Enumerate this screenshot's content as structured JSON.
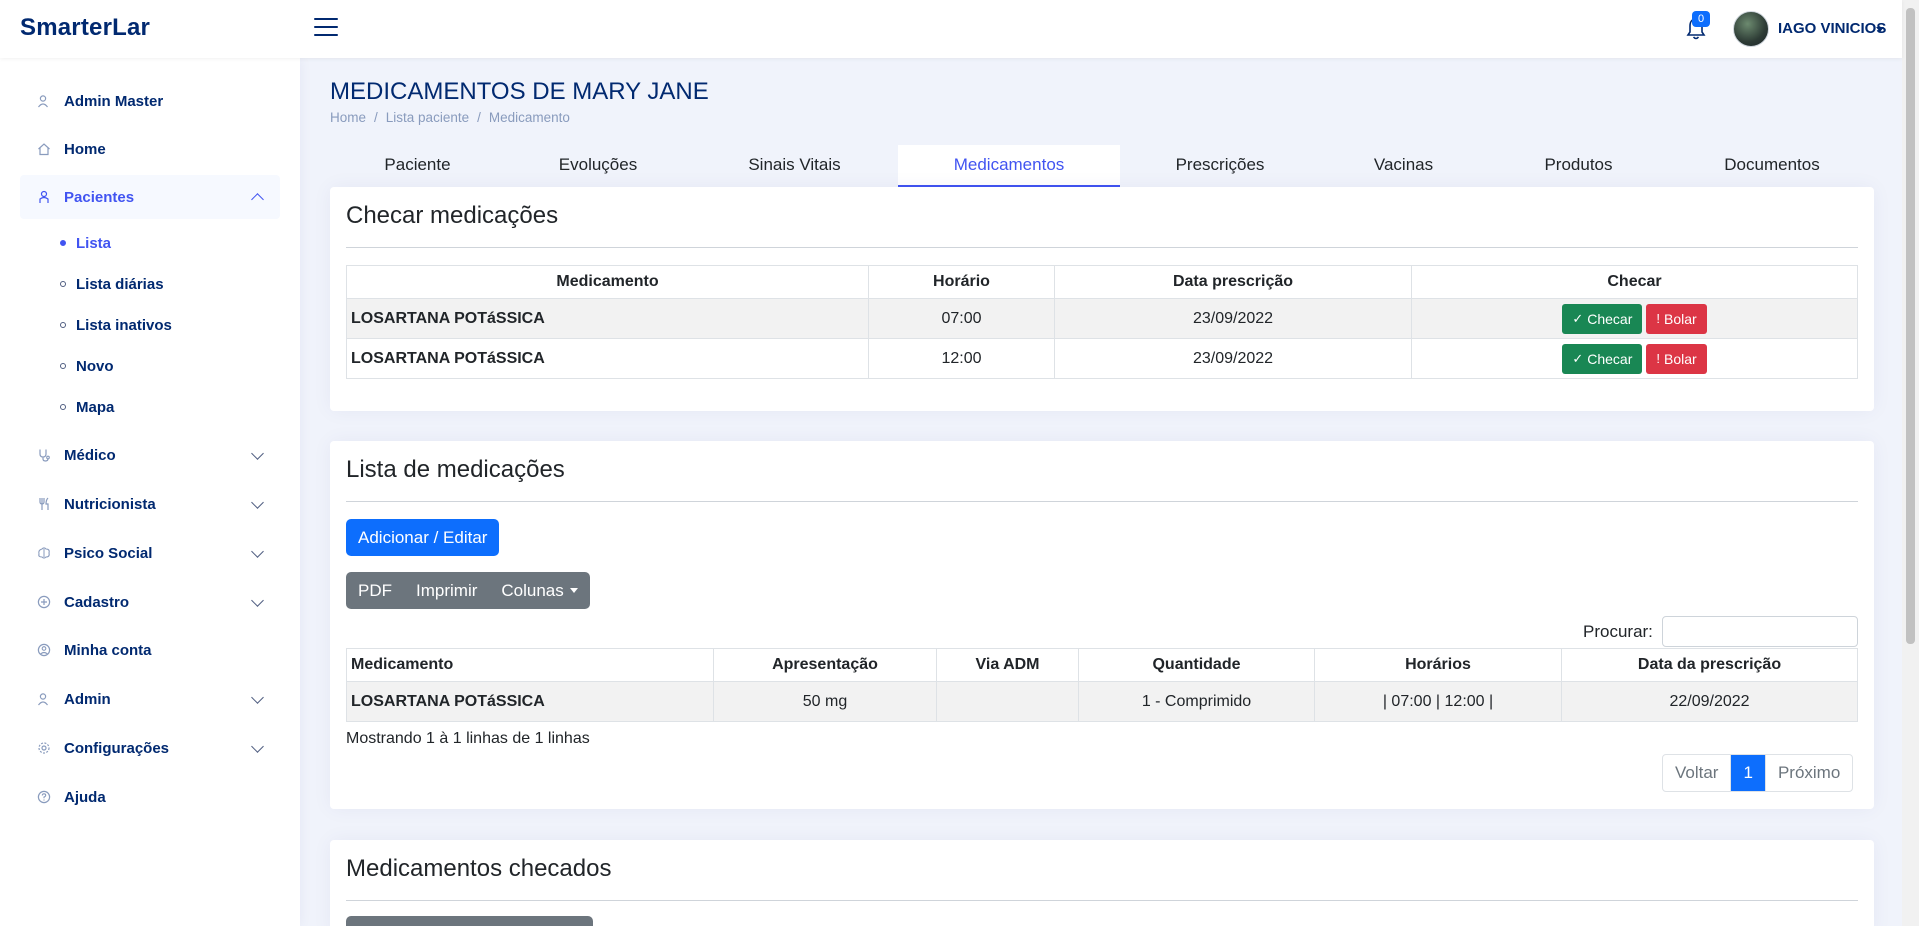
{
  "app": {
    "brand": "SmarterLar"
  },
  "header": {
    "notification_count": "0",
    "user_name": "IAGO VINICIOS"
  },
  "sidebar": {
    "items": [
      {
        "label": "Admin Master",
        "icon": "user-icon"
      },
      {
        "label": "Home",
        "icon": "home-icon"
      },
      {
        "label": "Pacientes",
        "icon": "person-icon",
        "expanded": true
      },
      {
        "label": "Médico",
        "icon": "stethoscope-icon"
      },
      {
        "label": "Nutricionista",
        "icon": "cutlery-icon"
      },
      {
        "label": "Psico Social",
        "icon": "brain-icon"
      },
      {
        "label": "Cadastro",
        "icon": "plus-circle-icon"
      },
      {
        "label": "Minha conta",
        "icon": "person-circle-icon"
      },
      {
        "label": "Admin",
        "icon": "user-gear-icon"
      },
      {
        "label": "Configurações",
        "icon": "gear-icon"
      },
      {
        "label": "Ajuda",
        "icon": "question-icon"
      }
    ],
    "pacientes_sub": [
      "Lista",
      "Lista diárias",
      "Lista inativos",
      "Novo",
      "Mapa"
    ]
  },
  "page": {
    "title": "MEDICAMENTOS DE MARY JANE",
    "breadcrumb": [
      "Home",
      "Lista paciente",
      "Medicamento"
    ]
  },
  "tabs": [
    "Paciente",
    "Evoluções",
    "Sinais Vitais",
    "Medicamentos",
    "Prescrições",
    "Vacinas",
    "Produtos",
    "Documentos"
  ],
  "checar": {
    "title": "Checar medicações",
    "headers": [
      "Medicamento",
      "Horário",
      "Data prescrição",
      "Checar"
    ],
    "rows": [
      {
        "medicamento": "LOSARTANA POTáSSICA",
        "horario": "07:00",
        "data": "23/09/2022"
      },
      {
        "medicamento": "LOSARTANA POTáSSICA",
        "horario": "12:00",
        "data": "23/09/2022"
      }
    ],
    "check_label": "Checar",
    "bolar_label": "Bolar"
  },
  "lista": {
    "title": "Lista de medicações",
    "add_button": "Adicionar / Editar",
    "export_buttons": [
      "PDF",
      "Imprimir",
      "Colunas"
    ],
    "search_label": "Procurar:",
    "headers": [
      "Medicamento",
      "Apresentação",
      "Via ADM",
      "Quantidade",
      "Horários",
      "Data da prescrição"
    ],
    "rows": [
      {
        "medicamento": "LOSARTANA POTáSSICA",
        "apresentacao": "50 mg",
        "via": "",
        "quantidade": "1 - Comprimido",
        "horarios": "| 07:00 | 12:00 |",
        "data": "22/09/2022"
      }
    ],
    "info": "Mostrando 1 à 1 linhas de 1 linhas",
    "pager": [
      "Voltar",
      "1",
      "Próximo"
    ]
  },
  "checados": {
    "title": "Medicamentos checados"
  },
  "colors": {
    "brand": "#012970",
    "accent": "#4154f1",
    "primary": "#0d6efd",
    "success": "#198754",
    "danger": "#dc3545"
  }
}
